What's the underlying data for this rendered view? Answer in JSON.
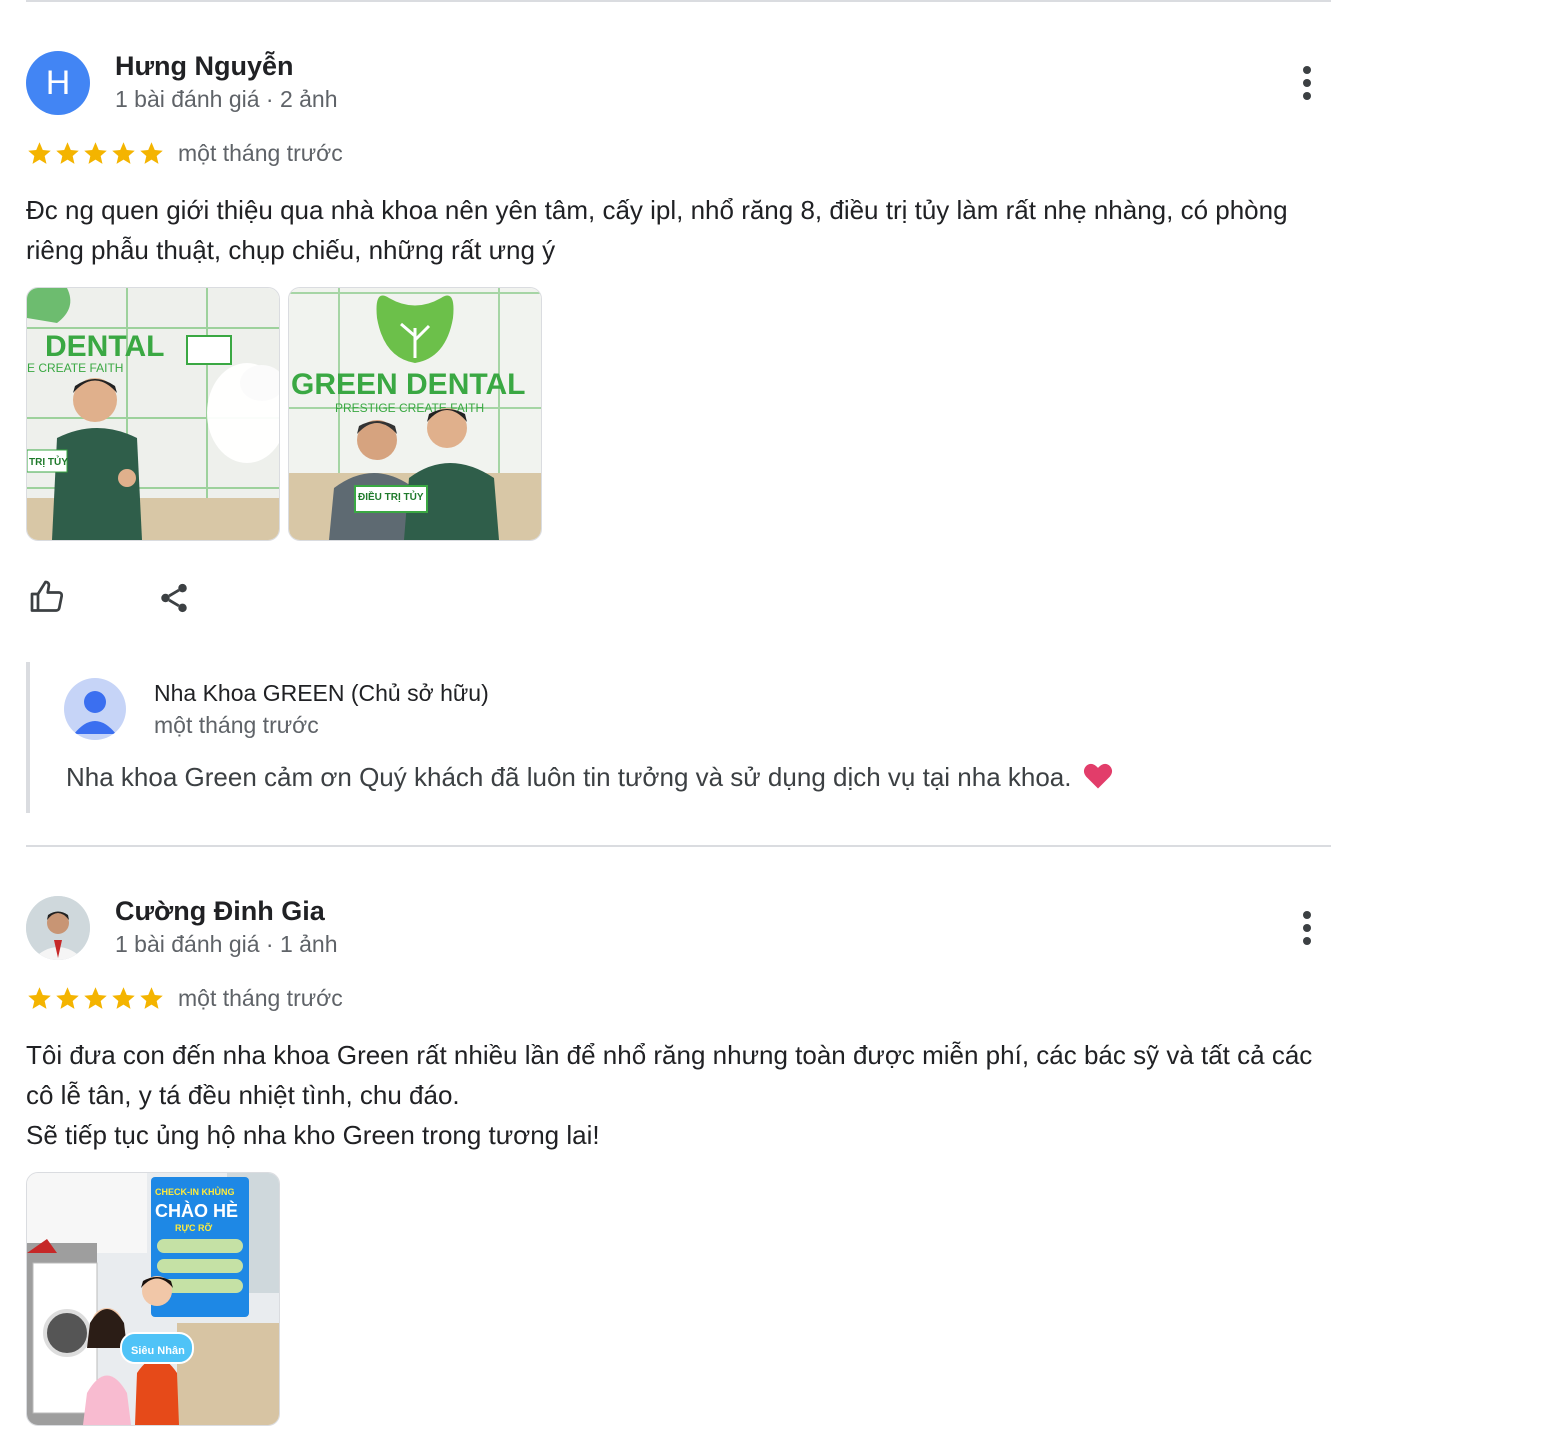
{
  "reviews": [
    {
      "author": "Hưng Nguyễn",
      "avatar_letter": "H",
      "meta": "1 bài đánh giá · 2 ảnh",
      "rating": 5,
      "time": "một tháng trước",
      "text": "Đc ng quen giới thiệu qua nhà khoa nên yên tâm, cấy ipl, nhổ răng 8, điều trị tủy làm rất nhẹ nhàng, có phòng riêng phẫu thuật, chụp chiếu, những rất ưng ý",
      "photos": [
        {
          "sign": "DENTAL",
          "tagline": "E CREATE FAITH",
          "card": "TRỊ TỦY"
        },
        {
          "sign": "GREEN DENTAL",
          "tagline": "PRESTIGE CREATE FAITH",
          "card": "ĐIỀU TRỊ TỦY"
        }
      ],
      "reply": {
        "owner": "Nha Khoa GREEN (Chủ sở hữu)",
        "time": "một tháng trước",
        "text": "Nha khoa Green cảm ơn Quý khách đã luôn tin tưởng và sử dụng dịch vụ tại nha khoa."
      }
    },
    {
      "author": "Cường Đinh Gia",
      "meta": "1 bài đánh giá · 1 ảnh",
      "rating": 5,
      "time": "một tháng trước",
      "text": "Tôi đưa con đến nha khoa Green rất nhiều lần để nhổ răng nhưng toàn được miễn phí, các bác sỹ và tất cả các cô lễ tân, y tá đều nhiệt tình, chu đáo.\nSẽ tiếp tục ủng hộ nha kho Green trong tương lai!",
      "photos": [
        {
          "banner_1": "CHECK-IN KHỦNG",
          "banner_2": "CHÀO HÈ",
          "banner_3": "RỰC RỠ",
          "card": "Siêu Nhân"
        }
      ]
    }
  ],
  "icons": {
    "star": "star-icon",
    "more": "more-vert-icon",
    "like": "thumb-up-icon",
    "share": "share-icon",
    "heart": "heart-emoji-icon",
    "default_avatar": "default-person-avatar-icon"
  },
  "colors": {
    "star": "#f4b400",
    "avatar_bg": "#4285f4",
    "divider": "#dadce0",
    "brand_green": "#39b54a",
    "heart": "#e23d6a"
  }
}
